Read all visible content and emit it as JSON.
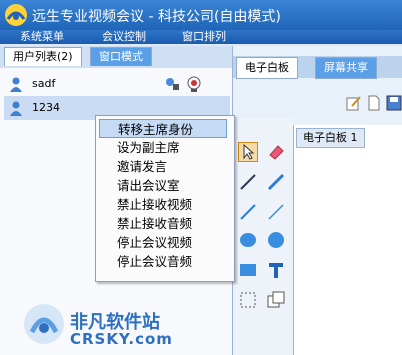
{
  "window": {
    "title": "远生专业视频会议 - 科技公司(自由模式)"
  },
  "menubar": {
    "items": [
      "系统菜单",
      "会议控制",
      "窗口排列"
    ]
  },
  "left_panel": {
    "tabs": [
      "用户列表(2)",
      "窗口模式"
    ],
    "users": [
      {
        "name": "sadf"
      },
      {
        "name": "1234"
      }
    ]
  },
  "context_menu": {
    "items": [
      "转移主席身份",
      "设为副主席",
      "邀请发言",
      "请出会议室",
      "禁止接收视频",
      "禁止接收音频",
      "停止会议视频",
      "停止会议音频"
    ],
    "selected_index": 0
  },
  "right_panel": {
    "tabs": [
      "电子白板",
      "屏幕共享"
    ],
    "whiteboard_tab": "电子白板 1"
  },
  "watermark": {
    "name": "非凡软件站",
    "site": "CRSKY.com"
  },
  "colors": {
    "title_bar": "#1f64b8",
    "menu_highlight": "#c5dbf5",
    "watermark": "#2e6fc0"
  }
}
